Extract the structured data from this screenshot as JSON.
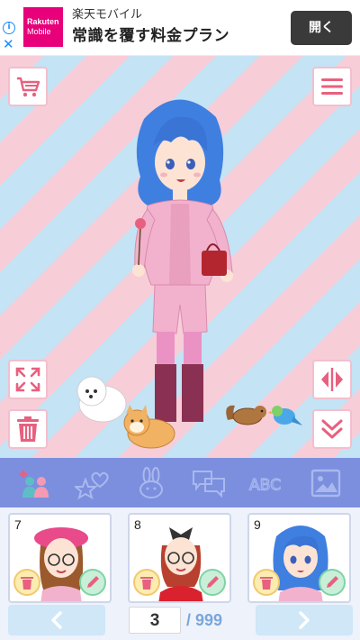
{
  "ad": {
    "info_icon": "info-icon",
    "close_icon": "close-icon",
    "logo_line1": "Rakuten",
    "logo_line2": "Mobile",
    "subtitle": "楽天モバイル",
    "title": "常識を覆す料金プラン",
    "open_label": "開く"
  },
  "stage": {
    "cart_icon": "shopping-cart-icon",
    "menu_icon": "hamburger-menu-icon",
    "expand_icon": "expand-arrows-icon",
    "flip_icon": "flip-horizontal-icon",
    "trash_icon": "trash-icon",
    "collapse_icon": "double-chevron-down-icon",
    "pets": [
      "white-puppy",
      "shiba-dog",
      "chipmunk",
      "blue-bird"
    ]
  },
  "toolbar": {
    "tools": [
      "add-character-icon",
      "stickers-icon",
      "bunny-pet-icon",
      "speech-bubble-icon",
      "text-abc-icon",
      "background-image-icon"
    ],
    "text_tool_label": "ABC"
  },
  "slots": [
    {
      "number": "7"
    },
    {
      "number": "8"
    },
    {
      "number": "9"
    }
  ],
  "pager": {
    "current": "3",
    "total": "/ 999",
    "prev_icon": "chevron-left-icon",
    "next_icon": "chevron-right-icon"
  },
  "colors": {
    "stripe_pink": "#f7cdd8",
    "stripe_blue": "#c4e3f5",
    "toolbar": "#7b8fde",
    "accent_pink": "#e8607f",
    "hair_blue": "#3f7fe0",
    "outfit_pink": "#f2b2cd"
  }
}
